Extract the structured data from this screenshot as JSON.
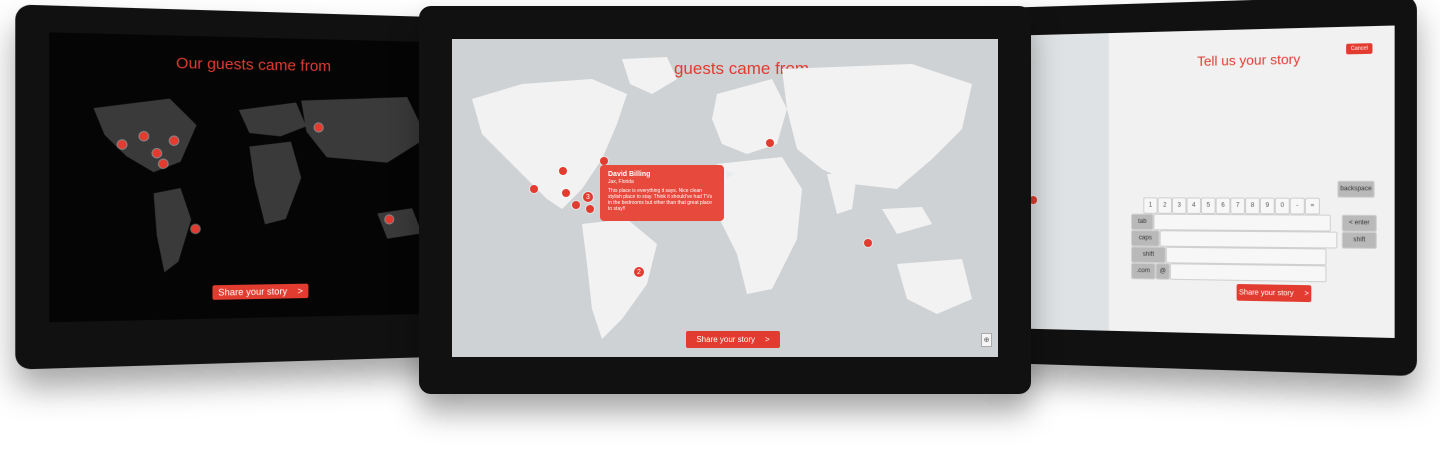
{
  "left_screen": {
    "title": "Our guests came from",
    "cta_label": "Share your story",
    "cta_arrow": ">"
  },
  "center_screen": {
    "title": "Our guests came from",
    "cta_label": "Share your story",
    "cta_arrow": ">",
    "popup": {
      "name": "David Billing",
      "location": "Jax, Florida",
      "story": "This place is everything it says. Nice clean stylish place to stay. Think it should've had TVs in the bedrooms but other than that great place to stay!!",
      "arrow": "▶"
    },
    "pins": [
      {
        "label": "3"
      },
      {
        "label": "2"
      }
    ],
    "corner_button": "⊕"
  },
  "right_screen": {
    "title": "Tell us your story",
    "cancel_label": "Cancel",
    "cta_label": "Share your story",
    "cta_arrow": ">",
    "keyboard": {
      "row1": [
        "1",
        "2",
        "3",
        "4",
        "5",
        "6",
        "7",
        "8",
        "9",
        "0",
        "-",
        "="
      ],
      "row2_first": "tab",
      "row3_first": "caps",
      "row4_first": "shift",
      "row5": [
        ".com",
        "@"
      ],
      "right_keys": [
        "backspace",
        "< enter",
        "shift"
      ]
    }
  },
  "colors": {
    "accent": "#e23b30",
    "dark_map_bg": "#000000",
    "light_map_bg": "#cfd2d4"
  }
}
